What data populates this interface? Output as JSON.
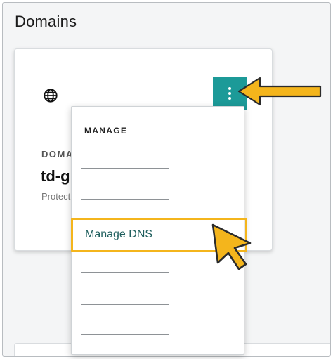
{
  "page": {
    "title": "Domains"
  },
  "card": {
    "icon": "globe-icon",
    "label": "DOMAI",
    "name": "td-g",
    "subtitle": "Protect"
  },
  "kebab_menu_button": {
    "icon": "vertical-ellipsis-icon",
    "color": "#1c9a98"
  },
  "dropdown": {
    "heading": "MANAGE",
    "items": [
      {
        "label": ""
      },
      {
        "label": ""
      },
      {
        "label": "Manage DNS",
        "highlighted": true
      },
      {
        "label": ""
      },
      {
        "label": ""
      },
      {
        "label": ""
      }
    ]
  },
  "annotations": {
    "highlight_color": "#f4b51c",
    "pointer_arrow_icon": "right-to-left-arrow-icon",
    "cursor_icon": "cursor-pointer-icon"
  }
}
